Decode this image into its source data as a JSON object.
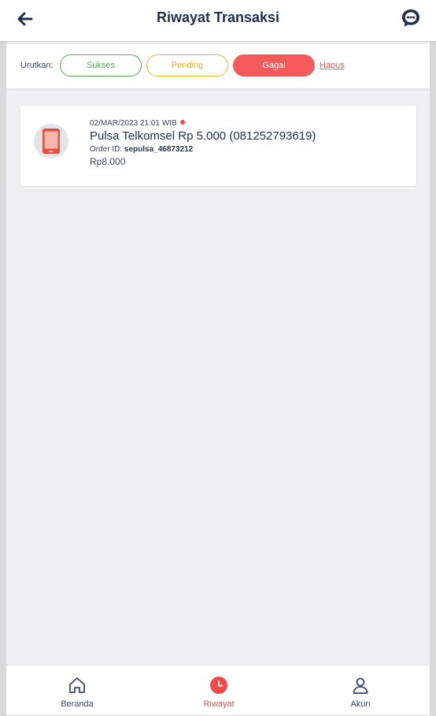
{
  "header": {
    "title": "Riwayat Transaksi",
    "back_icon": "arrow-left-icon",
    "chat_icon": "chat-support-icon"
  },
  "filters": {
    "label": "Urutkan:",
    "options": [
      {
        "label": "Sukses",
        "color": "#4caf50",
        "selected": false
      },
      {
        "label": "Pending",
        "color": "#f0b429",
        "selected": false
      },
      {
        "label": "Gagal",
        "color": "#f45a5a",
        "selected": true
      }
    ],
    "clear_label": "Hapus"
  },
  "transactions": [
    {
      "date": "02/MAR/2023 21:01 WIB",
      "status_color": "#f24848",
      "title": "Pulsa Telkomsel Rp 5.000 (081252793619)",
      "order_label": "Order ID:",
      "order_id": "sepulsa_46873212",
      "price": "Rp8.000",
      "icon": "phone-icon"
    }
  ],
  "bottom_nav": {
    "items": [
      {
        "label": "Beranda",
        "icon": "home-icon",
        "active": false
      },
      {
        "label": "Riwayat",
        "icon": "history-icon",
        "active": true
      },
      {
        "label": "Akun",
        "icon": "user-icon",
        "active": false
      }
    ],
    "active_color": "#f24848"
  }
}
